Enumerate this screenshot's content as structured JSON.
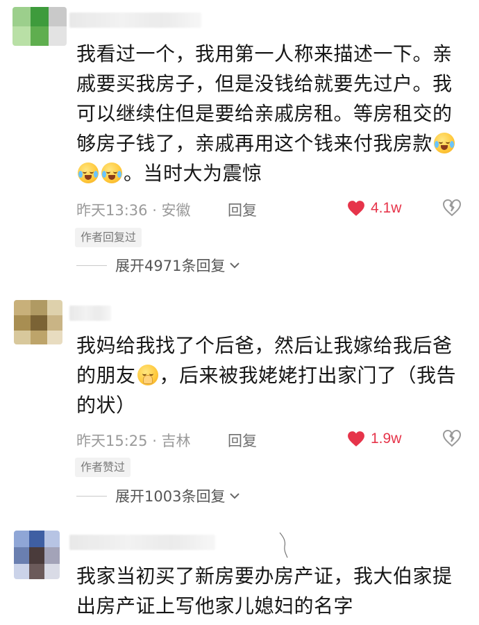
{
  "comments": [
    {
      "text_before_emoji": "我看过一个，我用第一人称来描述一下。亲戚要买我房子，但是没钱给就要先过户。我可以继续住但是要给亲戚房租。等房租交的够房子钱了，亲戚再用这个钱来付我房款",
      "emojis": [
        "cry-laugh-icon",
        "cry-laugh-icon",
        "cry-laugh-icon"
      ],
      "text_after_emoji": "。当时大为震惊",
      "time_location": "昨天13:36 · 安徽",
      "reply_label": "回复",
      "likes": "4.1w",
      "badge": "作者回复过",
      "expand_label": "展开4971条回复"
    },
    {
      "text_before_emoji": "我妈给我找了个后爸，然后让我嫁给我后爸的朋友",
      "emojis": [
        "pray-face-icon"
      ],
      "text_after_emoji": "，后来被我姥姥打出家门了（我告的状）",
      "time_location": "昨天15:25 · 吉林",
      "reply_label": "回复",
      "likes": "1.9w",
      "badge": "作者赞过",
      "expand_label": "展开1003条回复"
    },
    {
      "text_before_emoji": "我家当初买了新房要办房产证，我大伯家提出房产证上写他家儿媳妇的名字",
      "emojis": [],
      "text_after_emoji": ""
    }
  ],
  "colors": {
    "like": "#e6344a",
    "meta": "#9a9a9a",
    "text": "#161616"
  }
}
